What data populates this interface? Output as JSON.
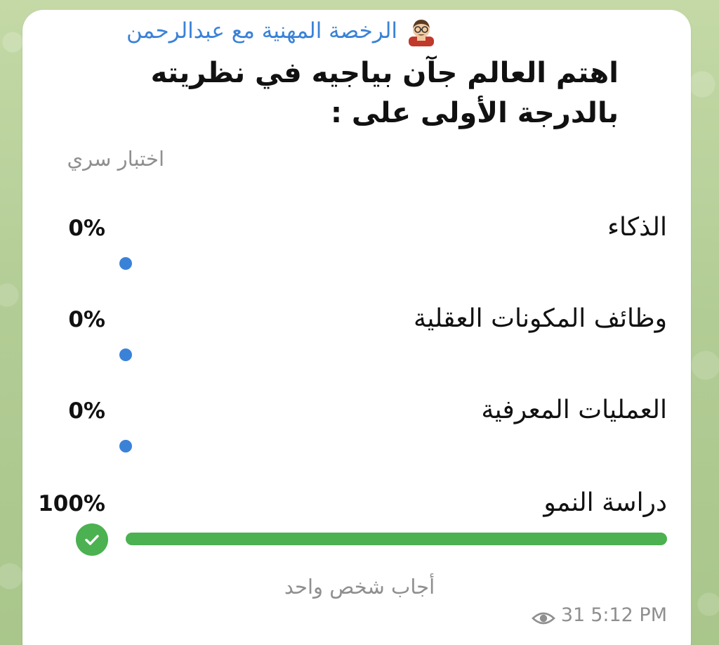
{
  "message": {
    "channel_name": "الرخصة المهنية مع عبدالرحمن",
    "channel_avatar": "man-with-glasses-emoji-icon",
    "question": "اهتم العالم جآن بياجيه في نظريته بالدرجة الأولى على :",
    "poll_type": "اختبار سري",
    "options": [
      {
        "label": "الذكاء",
        "percent": "0%",
        "share": 0,
        "selected": false
      },
      {
        "label": "وظائف المكونات العقلية",
        "percent": "0%",
        "share": 0,
        "selected": false
      },
      {
        "label": "العمليات المعرفية",
        "percent": "0%",
        "share": 0,
        "selected": false
      },
      {
        "label": "دراسة النمو",
        "percent": "100%",
        "share": 1,
        "selected": true
      }
    ],
    "votes_text": "أجاب شخص واحد",
    "views_icon": "eye-icon",
    "views": "31",
    "time": "5:12 PM"
  },
  "colors": {
    "accent": "#3a82d8",
    "correct": "#4cb151",
    "muted": "#8f8f8f"
  }
}
